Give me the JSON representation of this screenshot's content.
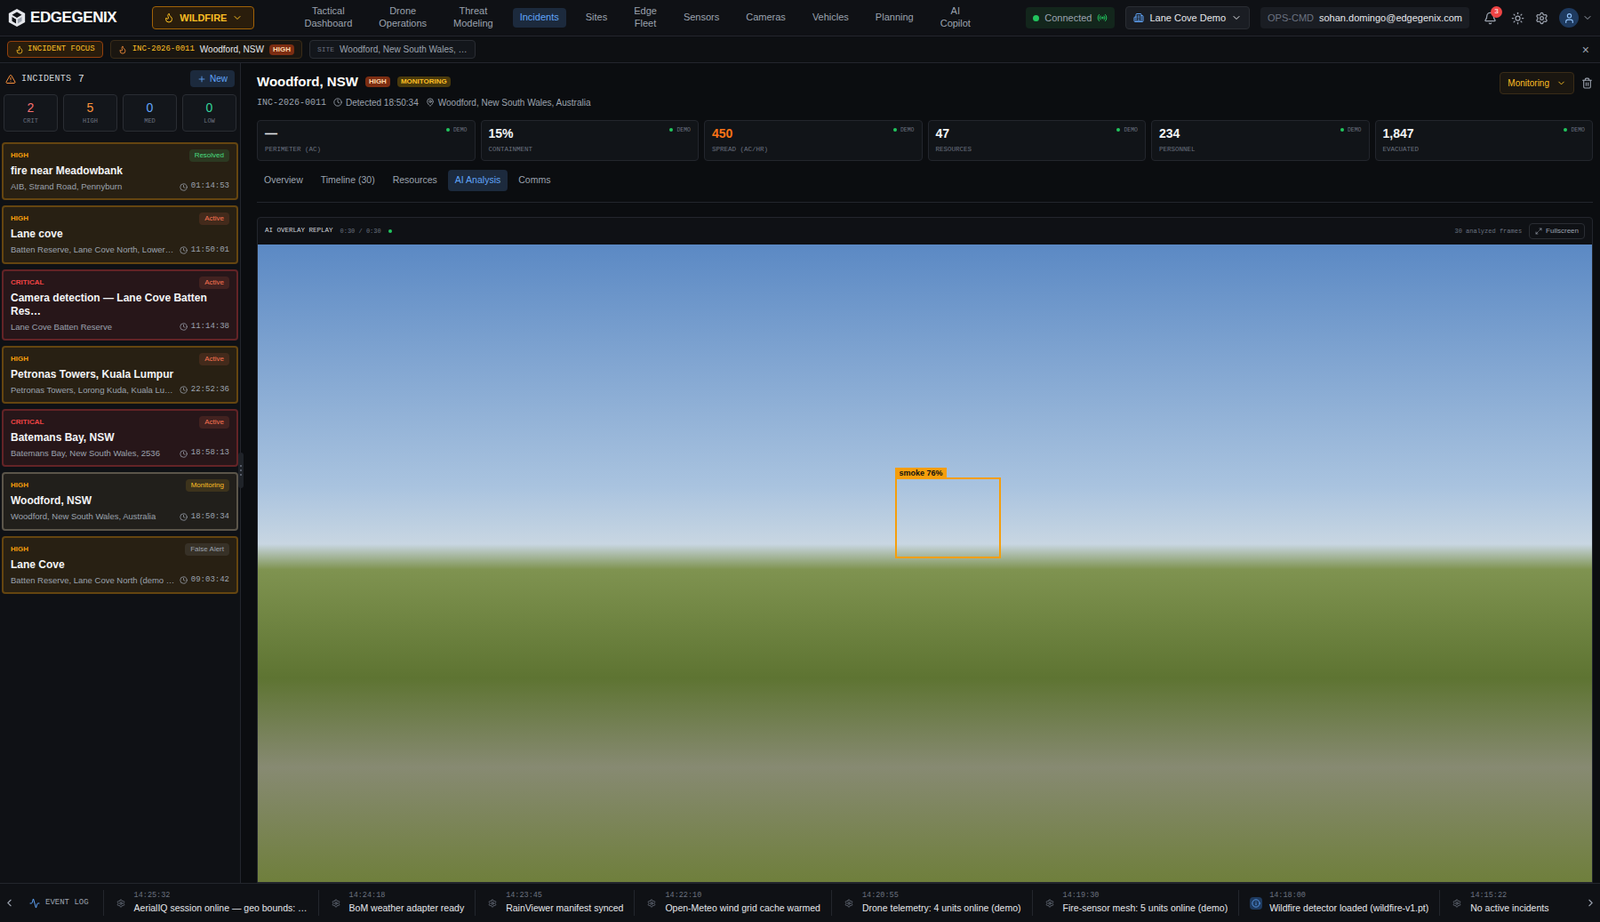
{
  "brand": {
    "name": "EDGEGENIX"
  },
  "mode": {
    "label": "WILDFIRE"
  },
  "nav": [
    {
      "label": "Tactical Dashboard",
      "selected": false
    },
    {
      "label": "Drone Operations",
      "selected": false
    },
    {
      "label": "Threat Modeling",
      "selected": false
    },
    {
      "label": "Incidents",
      "selected": true
    },
    {
      "label": "Sites",
      "selected": false
    },
    {
      "label": "Edge Fleet",
      "selected": false
    },
    {
      "label": "Sensors",
      "selected": false
    },
    {
      "label": "Cameras",
      "selected": false
    },
    {
      "label": "Vehicles",
      "selected": false
    },
    {
      "label": "Planning",
      "selected": false
    },
    {
      "label": "AI Copilot",
      "selected": false
    }
  ],
  "connection": {
    "label": "Connected",
    "connected": true
  },
  "site_selector": {
    "label": "Lane Cove Demo"
  },
  "user": {
    "role": "OPS-CMD",
    "email": "sohan.domingo@edgegenix.com"
  },
  "notifications": {
    "count": "3"
  },
  "focus_bar": {
    "badge": "INCIDENT FOCUS",
    "incident_id": "INC-2026-0011",
    "incident_name": "Woodford, NSW",
    "severity": "HIGH",
    "site_label": "SITE",
    "site_value": "Woodford, New South Wales, …",
    "close": "×"
  },
  "sidebar": {
    "title": "INCIDENTS",
    "count": "7",
    "new_button": "New",
    "stats": [
      {
        "value": "2",
        "label": "CRIT",
        "color": "#f87171"
      },
      {
        "value": "5",
        "label": "HIGH",
        "color": "#fb923c"
      },
      {
        "value": "0",
        "label": "MED",
        "color": "#60a5fa"
      },
      {
        "value": "0",
        "label": "LOW",
        "color": "#34d399"
      }
    ],
    "incidents": [
      {
        "severity": "HIGH",
        "status": "Resolved",
        "title": "fire near Meadowbank",
        "location": "AIB, Strand Road, Pennyburn",
        "time": "01:14:53",
        "selected": false,
        "color": "#f59e0b",
        "status_color": "#4ade80"
      },
      {
        "severity": "HIGH",
        "status": "Active",
        "title": "Lane cove",
        "location": "Batten Reserve, Lane Cove North, Lower…",
        "time": "11:50:01",
        "selected": false,
        "color": "#f59e0b",
        "status_color": "#f97352"
      },
      {
        "severity": "CRITICAL",
        "status": "Active",
        "title": "Camera detection — Lane Cove Batten Res…",
        "location": "Lane Cove Batten Reserve",
        "time": "11:14:38",
        "selected": false,
        "color": "#ef4444",
        "status_color": "#f97352"
      },
      {
        "severity": "HIGH",
        "status": "Active",
        "title": "Petronas Towers, Kuala Lumpur",
        "location": "Petronas Towers, Lorong Kuda, Kuala Lu…",
        "time": "22:52:36",
        "selected": false,
        "color": "#f59e0b",
        "status_color": "#f97352"
      },
      {
        "severity": "CRITICAL",
        "status": "Active",
        "title": "Batemans Bay, NSW",
        "location": "Batemans Bay, New South Wales, 2536",
        "time": "18:58:13",
        "selected": false,
        "color": "#ef4444",
        "status_color": "#f97352"
      },
      {
        "severity": "HIGH",
        "status": "Monitoring",
        "title": "Woodford, NSW",
        "location": "Woodford, New South Wales, Australia",
        "time": "18:50:34",
        "selected": true,
        "color": "#f59e0b",
        "status_color": "#fbbf24"
      },
      {
        "severity": "HIGH",
        "status": "False Alert",
        "title": "Lane Cove",
        "location": "Batten Reserve, Lane Cove North (demo …",
        "time": "09:03:42",
        "selected": false,
        "color": "#f59e0b",
        "status_color": "#9ca3af"
      }
    ]
  },
  "incident": {
    "title": "Woodford, NSW",
    "severity": "HIGH",
    "status": "MONITORING",
    "id": "INC-2026-0011",
    "detected": "Detected 18:50:34",
    "location": "Woodford, New South Wales, Australia",
    "status_select": "Monitoring",
    "stats": [
      {
        "value": "—",
        "label": "PERIMETER (AC)",
        "tag": "DEMO",
        "color": "#e5e7eb"
      },
      {
        "value": "15%",
        "label": "CONTAINMENT",
        "tag": "DEMO",
        "color": "#f3f4f6"
      },
      {
        "value": "450",
        "label": "SPREAD (AC/HR)",
        "tag": "DEMO",
        "color": "#f97316"
      },
      {
        "value": "47",
        "label": "RESOURCES",
        "tag": "DEMO",
        "color": "#f3f4f6"
      },
      {
        "value": "234",
        "label": "PERSONNEL",
        "tag": "DEMO",
        "color": "#f3f4f6"
      },
      {
        "value": "1,847",
        "label": "EVACUATED",
        "tag": "DEMO",
        "color": "#f3f4f6"
      }
    ],
    "tabs": [
      {
        "label": "Overview",
        "selected": false
      },
      {
        "label": "Timeline (30)",
        "selected": false
      },
      {
        "label": "Resources",
        "selected": false
      },
      {
        "label": "AI Analysis",
        "selected": true
      },
      {
        "label": "Comms",
        "selected": false
      }
    ]
  },
  "replay": {
    "title": "AI OVERLAY REPLAY",
    "time": "0:30 / 0:30",
    "live": true,
    "frames": "30 analyzed frames",
    "fullscreen": "Fullscreen",
    "detections": [
      {
        "label": "smoke 76%"
      }
    ]
  },
  "event_log": {
    "title": "EVENT LOG",
    "events": [
      {
        "time": "14:25:32",
        "text": "AerialIQ session online — geo bounds: …",
        "kind": "system"
      },
      {
        "time": "14:24:18",
        "text": "BoM weather adapter ready",
        "kind": "system"
      },
      {
        "time": "14:23:45",
        "text": "RainViewer manifest synced",
        "kind": "system"
      },
      {
        "time": "14:22:10",
        "text": "Open-Meteo wind grid cache warmed",
        "kind": "system"
      },
      {
        "time": "14:20:55",
        "text": "Drone telemetry: 4 units online (demo)",
        "kind": "system"
      },
      {
        "time": "14:19:30",
        "text": "Fire-sensor mesh: 5 units online (demo)",
        "kind": "system"
      },
      {
        "time": "14:18:00",
        "text": "Wildfire detector loaded (wildfire-v1.pt)",
        "kind": "info"
      },
      {
        "time": "14:15:22",
        "text": "No active incidents",
        "kind": "system"
      }
    ]
  }
}
